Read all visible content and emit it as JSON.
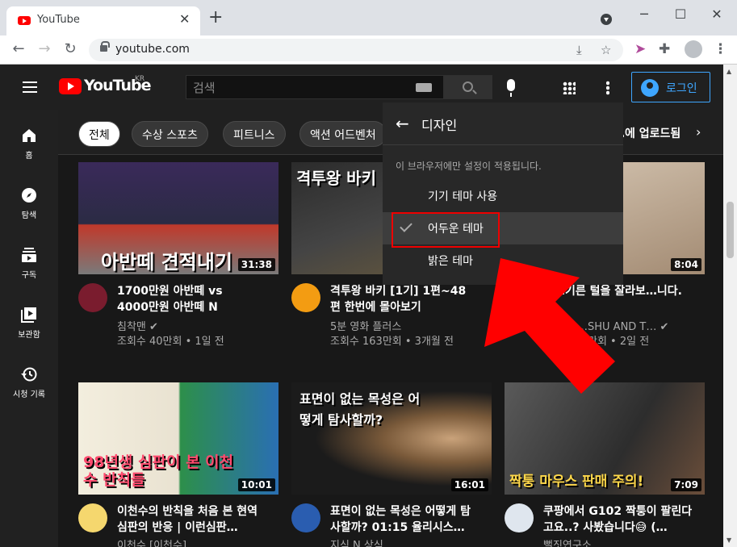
{
  "browser": {
    "tab_title": "YouTube",
    "url": "youtube.com"
  },
  "youtube": {
    "logo_text": "YouTube",
    "logo_region": "KR",
    "search_placeholder": "검색",
    "login_label": "로그인",
    "sidebar": [
      {
        "icon": "home-icon",
        "label": "홈"
      },
      {
        "icon": "explore-icon",
        "label": "탐색"
      },
      {
        "icon": "subscriptions-icon",
        "label": "구독"
      },
      {
        "icon": "library-icon",
        "label": "보관함"
      },
      {
        "icon": "history-icon",
        "label": "시청 기록"
      }
    ],
    "chips": [
      "전체",
      "수상 스포츠",
      "피트니스",
      "액션 어드벤처",
      "…에 업로드됨"
    ],
    "videos": [
      {
        "title": "1700만원 아반떼 vs 4000만원 아반떼 N",
        "channel": "침착맨",
        "meta": "조회수 40만회 • 1일 전",
        "duration": "31:38",
        "thumb_text": "아반떼 견적내기",
        "verified": true
      },
      {
        "title": "격투왕 바키 [1기] 1편~48편 한번에 몰아보기",
        "channel": "5분 영화 플러스",
        "meta": "조회수 163만회 • 3개월 전",
        "duration": "",
        "thumb_text": "격투왕 바키",
        "verified": false
      },
      {
        "title": "…기른 털을 잘라보…니다.",
        "channel": "…SHU AND T…",
        "meta": "…만회 • 2일 전",
        "duration": "8:04",
        "thumb_text": "",
        "verified": true
      },
      {
        "title": "이천수의 반칙을 처음 본 현역심판의 반응 | 이런심판…",
        "channel": "이천수 [이천수]",
        "meta": "",
        "duration": "10:01",
        "thumb_text": "98년생 심판이 본 이천수 반칙들",
        "verified": false
      },
      {
        "title": "표면이 없는 목성은 어떻게 탐사할까? 01:15 율리시스…",
        "channel": "지식 N 상식",
        "meta": "",
        "duration": "16:01",
        "thumb_text": "표면이 없는 목성은 어떻게 탐사할까?",
        "verified": false
      },
      {
        "title": "쿠팡에서 G102 짝퉁이 팔린다고요..? 사봤습니다😅 (…",
        "channel": "뻘짓연구소",
        "meta": "",
        "duration": "7:09",
        "thumb_text": "짝퉁 마우스 판매 주의!",
        "verified": false
      }
    ],
    "appearance_menu": {
      "header": "디자인",
      "note": "이 브라우저에만 설정이 적용됩니다.",
      "options": [
        "기기 테마 사용",
        "어두운 테마",
        "밝은 테마"
      ],
      "selected": "어두운 테마"
    }
  },
  "colors": {
    "accent": "#3ea6ff",
    "brand": "#ff0000",
    "annotation": "#e00000"
  }
}
